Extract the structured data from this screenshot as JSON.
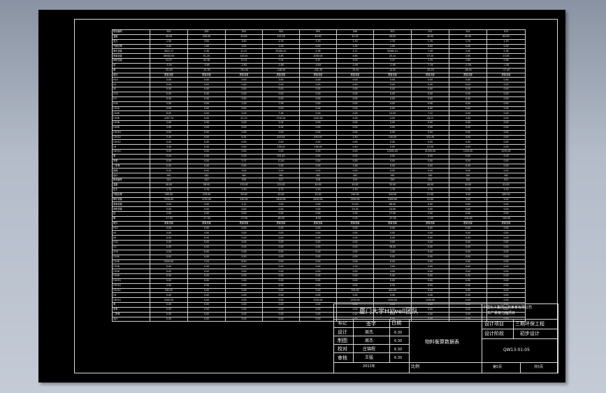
{
  "table": {
    "rows": [
      [
        "物流编号",
        "S01",
        "S02",
        "S03",
        "S04",
        "S05",
        "S06",
        "S07",
        "S11",
        "S12",
        "S13"
      ],
      [
        "温度",
        "45.00",
        "200.00",
        "40.00",
        "115.78",
        "40.00",
        "41.22",
        "26.02",
        "40.00",
        "40.00",
        "80.00"
      ],
      [
        "压力",
        "1.50",
        "3.50",
        "3.50",
        "1.70",
        "1.70",
        "1.70",
        "1.70",
        "1.70",
        "1.70",
        "1.70"
      ],
      [
        "气相分率",
        "0.00",
        "1.00",
        "0.00",
        "1.00",
        "0.00",
        "1.00",
        "1.00",
        "0.00",
        "0.00",
        "0.00"
      ],
      [
        "摩尔流量",
        "2622.17",
        "4.36",
        "21.57",
        "20262.41",
        "2.36",
        "2.17",
        "30460.41",
        "7.49",
        "2.00",
        "2.38"
      ],
      [
        "质量流量",
        "46500.00",
        "61.20",
        "120.01",
        "4.85",
        "1000.00",
        "4.60",
        "20.14",
        "27.20",
        "2.00",
        "23.00"
      ],
      [
        "体积流量",
        "54.57",
        "40.38",
        "13.22",
        "7.04",
        "9.37",
        "5.00",
        "3.47",
        "1.35",
        "2.60",
        "0.98"
      ],
      [
        "焓",
        "-3.54",
        "-3.85",
        "-2.62",
        "-2.80",
        "-4.04",
        "-2.95",
        "-2.90",
        "-7.04",
        "-1.28",
        "-1.28"
      ],
      [
        "熵",
        "-92.00",
        "-25.30",
        "-151.00",
        "-148.50",
        "-102.30",
        "-70.20",
        "-8.30",
        "-53.20",
        "-38.00",
        "-17.40"
      ],
      [
        "组分",
        "质量流量",
        "质量流量",
        "质量流量",
        "质量流量",
        "质量流量",
        "质量流量",
        "质量流量",
        "质量流量",
        "质量流量",
        "质量流量"
      ],
      [
        "H2O",
        "0.00",
        "0.00",
        "0.00",
        "0.00",
        "0.00",
        "0.00",
        "0.00",
        "0.00",
        "0.00",
        "0.00"
      ],
      [
        "H2",
        "0.00",
        "0.00",
        "0.00",
        "0.00",
        "0.00",
        "0.00",
        "0.00",
        "0.00",
        "0.00",
        "0.00"
      ],
      [
        "N2",
        "0.00",
        "0.00",
        "0.00",
        "0.00",
        "0.00",
        "0.00",
        "0.00",
        "0.00",
        "0.00",
        "0.00"
      ],
      [
        "CO2",
        "0.00",
        "0.00",
        "0.00",
        "0.00",
        "0.00",
        "0.00",
        "0.00",
        "0.00",
        "0.00",
        "0.00"
      ],
      [
        "CO",
        "0.00",
        "0.00",
        "0.00",
        "0.00",
        "0.00",
        "0.00",
        "0.00",
        "0.00",
        "0.00",
        "0.00"
      ],
      [
        "CH4",
        "2.00",
        "0.00",
        "1.00",
        "7.09",
        "0.00",
        "0.00",
        "0.00",
        "0.00",
        "0.00",
        "0.00"
      ],
      [
        "C2H4",
        "0.00",
        "0.00",
        "0.00",
        "0.00",
        "0.00",
        "0.00",
        "0.00",
        "0.00",
        "0.00",
        "0.00"
      ],
      [
        "C2H6",
        "8.00",
        "0.00",
        "0.00",
        "7.46",
        "0.00",
        "0.00",
        "24.00",
        "7.12",
        "0.00",
        "0.00"
      ],
      [
        "C3H6",
        "1297.74",
        "0.00",
        "21.23",
        "1700.24",
        "1240.26",
        "4.00",
        "0.00",
        "18.12",
        "2.00",
        "0.00"
      ],
      [
        "C3H8",
        "2.00",
        "0.00",
        "0.00",
        "2.02",
        "0.00",
        "0.00",
        "0.00",
        "0.00",
        "0.00",
        "0.00"
      ],
      [
        "C4H8",
        "2.00",
        "0.00",
        "0.00",
        "4.04",
        "0.00",
        "0.00",
        "0.00",
        "0.00",
        "0.00",
        "0.00"
      ],
      [
        "C4H10",
        "0.00",
        "0.00",
        "0.00",
        "0.00",
        "0.00",
        "0.00",
        "0.00",
        "0.00",
        "0.00",
        "0.00"
      ],
      [
        "C5H10",
        "2.40",
        "0.00",
        "6.32",
        "423.40",
        "450.00",
        "2.40",
        "140.00",
        "322.40",
        "0.00",
        "0.00"
      ],
      [
        "C5H12",
        "0.00",
        "0.00",
        "0.00",
        "0.00",
        "0.00",
        "0.00",
        "0.00",
        "0.00",
        "0.00",
        "0.00"
      ],
      [
        "C6",
        "3.00",
        "0.00",
        "0.00",
        "236.20",
        "236.00",
        "0.40",
        "0.00",
        "12.20",
        "0.00",
        "0.00"
      ],
      [
        "C6H14",
        "0.00",
        "0.00",
        "0.00",
        "0.00",
        "0.00",
        "0.00",
        "12000.00",
        "41200.00",
        "1200.00",
        "1250.00"
      ],
      [
        "苯",
        "0.00",
        "0.00",
        "0.00",
        "302.40",
        "0.00",
        "0.00",
        "0.00",
        "0.00",
        "0.00",
        "0.00"
      ],
      [
        "甲苯",
        "0.00",
        "0.00",
        "2.37",
        "12.40",
        "0.00",
        "0.00",
        "0.00",
        "0.00",
        "0.00",
        "0.00"
      ],
      [
        "二甲苯",
        "0.00",
        "0.00",
        "0.00",
        "0.00",
        "0.00",
        "1.48",
        "0.00",
        "0.00",
        "0.00",
        "0.00"
      ],
      [
        "其他",
        "0.00",
        "0.00",
        "0.00",
        "0.00",
        "0.00",
        "0.00",
        "0.00",
        "0.00",
        "0.00",
        "0.00"
      ],
      [
        "合计",
        "282",
        "282",
        "282",
        "282",
        "282",
        "282",
        "282",
        "282",
        "282",
        "282"
      ],
      [
        "物流编号",
        "S14",
        "S15",
        "S16",
        "S17",
        "S18",
        "S19",
        "S20",
        "S21",
        "S22",
        "S23"
      ],
      [
        "温度",
        "40.00",
        "58.00",
        "123.00",
        "123.00",
        "40.00",
        "40.00",
        "35.00",
        "40.00",
        "40.00",
        "40.00"
      ],
      [
        "压力",
        "1.70",
        "1.70",
        "1.70",
        "1.70",
        "1.70",
        "1.70",
        "1.70",
        "1.70",
        "1.70",
        "1.70"
      ],
      [
        "气相分率",
        "185.00",
        "229.00",
        "50.00",
        "45.00",
        "12.00",
        "344.00",
        "344.00",
        "12.00",
        "3.00",
        "483.00"
      ],
      [
        "摩尔流量",
        "7250.00",
        "1232.00",
        "240.00",
        "2400.00",
        "2400.00",
        "1300.00",
        "2400.00",
        "12.00",
        "3.00",
        "2.00"
      ],
      [
        "质量流量",
        "0.00",
        "4.00",
        "1.12",
        "0.00",
        "0.00",
        "23.40",
        "88.00",
        "0.00",
        "0.00",
        "0.00"
      ],
      [
        "体积流量",
        "0.00",
        "0.00",
        "0.00",
        "0.00",
        "0.00",
        "24.00",
        "24.00",
        "0.00",
        "0.00",
        "0.00"
      ],
      [
        "焓",
        "2.00",
        "2.00",
        "0.00",
        "0.00",
        "0.00",
        "1.00",
        "27.00",
        "2.00",
        "0.00",
        "0.00"
      ],
      [
        "熵",
        "-17.00",
        "-17.00",
        "-17.00",
        "-62.00",
        "-6.00",
        "0.00",
        "-27.00",
        "-1.00",
        "-100.00",
        "-100.00"
      ],
      [
        "组分",
        "质量流量",
        "质量流量",
        "质量流量",
        "质量流量",
        "质量流量",
        "质量流量",
        "质量流量",
        "质量流量",
        "质量流量",
        "质量流量"
      ],
      [
        "H2O",
        "0.00",
        "0.00",
        "0.00",
        "0.00",
        "0.00",
        "0.00",
        "0.00",
        "0.00",
        "0.00",
        "0.00"
      ],
      [
        "H2",
        "0.00",
        "0.00",
        "0.00",
        "0.00",
        "0.00",
        "0.00",
        "0.00",
        "0.00",
        "0.00",
        "0.00"
      ],
      [
        "N2",
        "0.00",
        "0.00",
        "0.00",
        "0.00",
        "0.00",
        "0.00",
        "0.00",
        "0.00",
        "0.00",
        "0.00"
      ],
      [
        "CO2",
        "0.00",
        "0.00",
        "0.00",
        "0.00",
        "0.00",
        "0.00",
        "0.00",
        "0.00",
        "0.00",
        "0.00"
      ],
      [
        "CO",
        "0.00",
        "0.00",
        "0.00",
        "0.00",
        "0.00",
        "0.00",
        "36.00",
        "0.00",
        "0.00",
        "0.00"
      ],
      [
        "CH4",
        "0.00",
        "0.00",
        "0.00",
        "0.00",
        "0.00",
        "0.00",
        "0.00",
        "0.00",
        "0.00",
        "0.00"
      ],
      [
        "C2H4",
        "0.00",
        "0.00",
        "0.00",
        "0.00",
        "0.00",
        "0.00",
        "0.00",
        "0.00",
        "0.00",
        "0.00"
      ],
      [
        "C2H6",
        "2000.00",
        "7.24",
        "8.20",
        "0.00",
        "0.00",
        "0.00",
        "0.00",
        "0.00",
        "0.00",
        "0.00"
      ],
      [
        "C3H6",
        "0.00",
        "0.00",
        "0.00",
        "0.00",
        "0.00",
        "1.00",
        "2.00",
        "2.00",
        "0.00",
        "0.00"
      ],
      [
        "C3H8",
        "0.00",
        "0.00",
        "0.00",
        "0.00",
        "0.00",
        "0.00",
        "0.00",
        "0.00",
        "0.00",
        "0.00"
      ],
      [
        "C4H8",
        "0.00",
        "0.00",
        "0.00",
        "0.00",
        "0.00",
        "0.00",
        "0.00",
        "0.00",
        "0.00",
        "0.00"
      ],
      [
        "C4H10",
        "0.00",
        "0.00",
        "1.00",
        "0.00",
        "0.00",
        "0.00",
        "0.00",
        "0.00",
        "0.00",
        "0.00"
      ],
      [
        "C5H10",
        "0.00",
        "0.00",
        "0.00",
        "0.00",
        "0.00",
        "0.00",
        "0.00",
        "0.00",
        "0.00",
        "0.00"
      ],
      [
        "C5H12",
        "182.00",
        "0.00",
        "0.00",
        "0.00",
        "0.00",
        "300.00",
        "402.00",
        "0.00",
        "0.00",
        "0.00"
      ],
      [
        "C6",
        "0.00",
        "0.00",
        "0.00",
        "0.00",
        "0.00",
        "0.00",
        "0.00",
        "0.00",
        "0.00",
        "0.00"
      ],
      [
        "C6H14",
        "2000.00",
        "0.00",
        "0.00",
        "0.00",
        "1200.00",
        "1200.00",
        "1200.00",
        "1200.00",
        "0.00",
        "0.00"
      ],
      [
        "苯",
        "0.00",
        "0.00",
        "0.00",
        "0.00",
        "0.00",
        "0.00",
        "0.00",
        "0.00",
        "0.00",
        "0.00"
      ],
      [
        "甲苯",
        "0.00",
        "0.00",
        "0.00",
        "0.00",
        "0.00",
        "0.00",
        "0.00",
        "0.00",
        "0.00",
        "0.00"
      ],
      [
        "二甲苯",
        "0.00",
        "0.00",
        "0.00",
        "0.00",
        "0.00",
        "0.00",
        "0.00",
        "0.00",
        "0.00",
        "0.00"
      ],
      [
        "合计",
        "0.00",
        "0.00",
        "0.00",
        "0.00",
        "0.00",
        "0.00",
        "0.00",
        "0.00",
        "0.00",
        "0.00"
      ]
    ]
  },
  "title_block": {
    "team": "厦门大学Hawell团队",
    "company": "中国化工集团公司某某有限公司",
    "company_sub": "年产某某万吨项目",
    "heading_marker": "标记",
    "heading_sign": "签字",
    "heading_date": "日期",
    "role_design": "设计",
    "role_draw": "制图",
    "role_check": "校对",
    "role_review": "审核",
    "name_design": "周杰",
    "name_draw": "周杰",
    "name_check": "庄锦程",
    "name_review": "王猛",
    "date_design": "6.30",
    "date_draw": "6.30",
    "date_check": "6.30",
    "date_review": "6.30",
    "drawing_title": "物料衡算数据表",
    "project_label": "设计项目",
    "project_value": "三期环保工程",
    "stage_label": "设计阶段",
    "stage_value": "初步设计",
    "drawing_no": "QW13-01-05",
    "year": "2013年",
    "scale_label": "比例",
    "sheet_label": "第5页",
    "total_label": "共5页"
  }
}
